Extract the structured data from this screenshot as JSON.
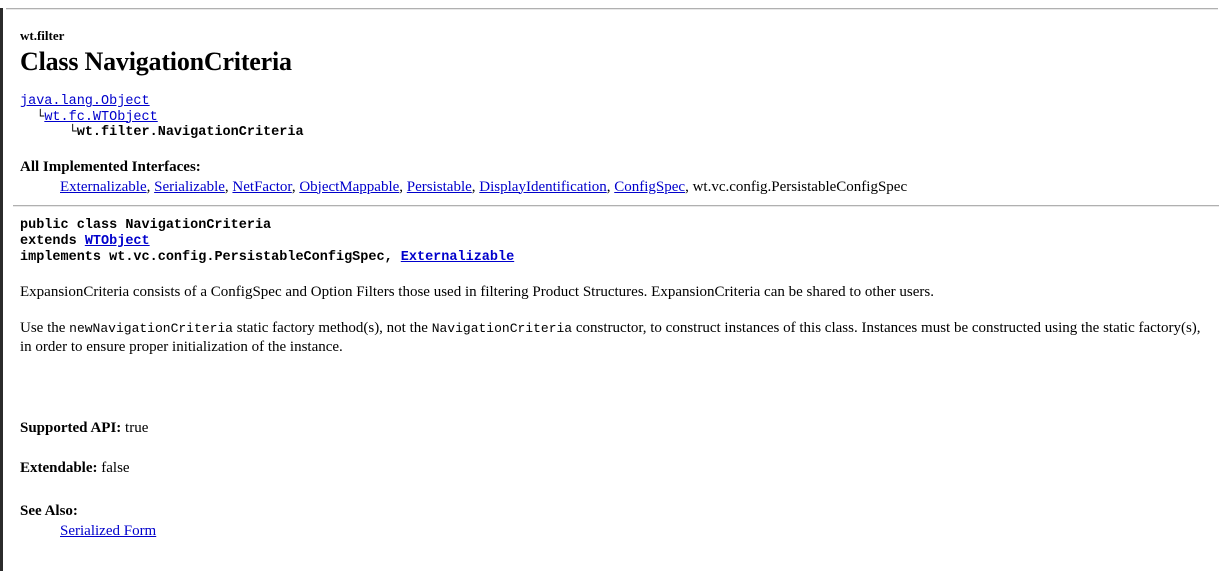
{
  "document": {
    "package": "wt.filter",
    "title": "Class NavigationCriteria"
  },
  "hierarchy": {
    "levels": [
      {
        "text": "java.lang.Object",
        "link": true,
        "indent": ""
      },
      {
        "text": "wt.fc.WTObject",
        "link": true,
        "indent": "  └"
      },
      {
        "text": "wt.filter.NavigationCriteria",
        "link": false,
        "indent": "      └"
      }
    ],
    "line1_label": "java.lang.Object",
    "line2_connector": "  └",
    "line2_label": "wt.fc.WTObject",
    "line3_connector": "      └",
    "line3_label": "wt.filter.NavigationCriteria"
  },
  "interfaces": {
    "heading": "All Implemented Interfaces:",
    "items": [
      {
        "label": "Externalizable",
        "link": true
      },
      {
        "label": "Serializable",
        "link": true
      },
      {
        "label": "NetFactor",
        "link": true
      },
      {
        "label": "ObjectMappable",
        "link": true
      },
      {
        "label": "Persistable",
        "link": true
      },
      {
        "label": "DisplayIdentification",
        "link": true
      },
      {
        "label": "ConfigSpec",
        "link": true
      },
      {
        "label": "wt.vc.config.PersistableConfigSpec",
        "link": false
      }
    ]
  },
  "declaration": {
    "line1": "public class NavigationCriteria",
    "line2_keyword": "extends ",
    "line2_type": "WTObject",
    "line3_keyword": "implements ",
    "line3_type_plain": "wt.vc.config.PersistableConfigSpec, ",
    "line3_type_link": "Externalizable"
  },
  "description": {
    "paragraph1": "ExpansionCriteria consists of a ConfigSpec and Option Filters those used in filtering Product Structures. ExpansionCriteria can be shared to other users.",
    "paragraph2_a": "Use the ",
    "paragraph2_code1": "newNavigationCriteria",
    "paragraph2_b": " static factory method(s), not the ",
    "paragraph2_code2": "NavigationCriteria",
    "paragraph2_c": " constructor, to construct instances of this class. Instances must be constructed using the static factory(s), in order to ensure proper initialization of the instance."
  },
  "metadata": {
    "supported_api_label": "Supported API:",
    "supported_api_value": "true",
    "extendable_label": "Extendable:",
    "extendable_value": "false"
  },
  "see_also": {
    "heading": "See Also:",
    "link_label": "Serialized Form"
  },
  "colors": {
    "link": "#0000cc",
    "rule": "#b0b0b0",
    "frame_border": "#2b2b2b",
    "text": "#000000"
  }
}
